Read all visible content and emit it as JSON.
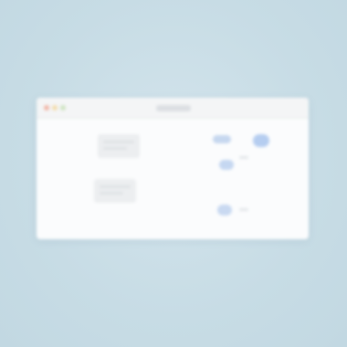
{
  "window": {
    "title": ""
  },
  "colors": {
    "background": "#c9dde6",
    "window": "#fbfcfd",
    "accent": "#b5cdf0",
    "close": "#f1b7a8",
    "minimize": "#f3dcae",
    "maximize": "#cfe4c2"
  },
  "icons": [
    "close-icon",
    "minimize-icon",
    "maximize-icon"
  ]
}
